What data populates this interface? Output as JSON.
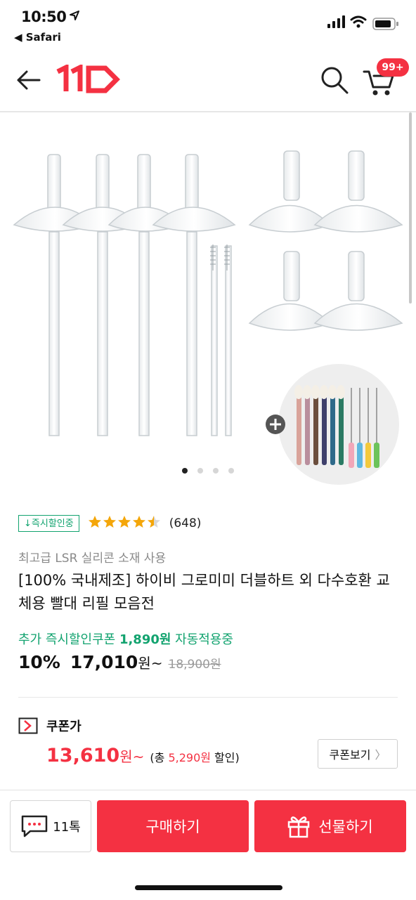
{
  "status_bar": {
    "time": "10:50",
    "back_app": "◀ Safari"
  },
  "header": {
    "cart_badge": "99+"
  },
  "carousel": {
    "total": 4,
    "active_index": 0
  },
  "product": {
    "instant_tag": "↓즉시할인중",
    "rating": 4.5,
    "stars": "★★★★★",
    "review_count": "(648)",
    "subtitle": "최고급 LSR 실리콘 소재 사용",
    "title": "[100% 국내제조] 하이비 그로미미 더블하트 외 다수호환 교체용 빨대 리필 모음전",
    "coupon_line_prefix": "추가 즉시할인쿠폰 ",
    "coupon_line_amount": "1,890원",
    "coupon_line_suffix": " 자동적용중",
    "discount": "10%",
    "price": "17,010",
    "price_unit": "원~",
    "original_price": "18,900원"
  },
  "coupon": {
    "label": "쿠폰가",
    "price": "13,610",
    "price_unit": "원~",
    "discount_prefix": "(총 ",
    "discount_amount": "5,290원",
    "discount_suffix": " 할인)",
    "view_button": "쿠폰보기"
  },
  "bottom_bar": {
    "chat_label": "11톡",
    "buy_label": "구매하기",
    "gift_label": "선물하기"
  },
  "colors": {
    "accent": "#f43142",
    "green": "#12a36f",
    "star": "#f4a609"
  }
}
